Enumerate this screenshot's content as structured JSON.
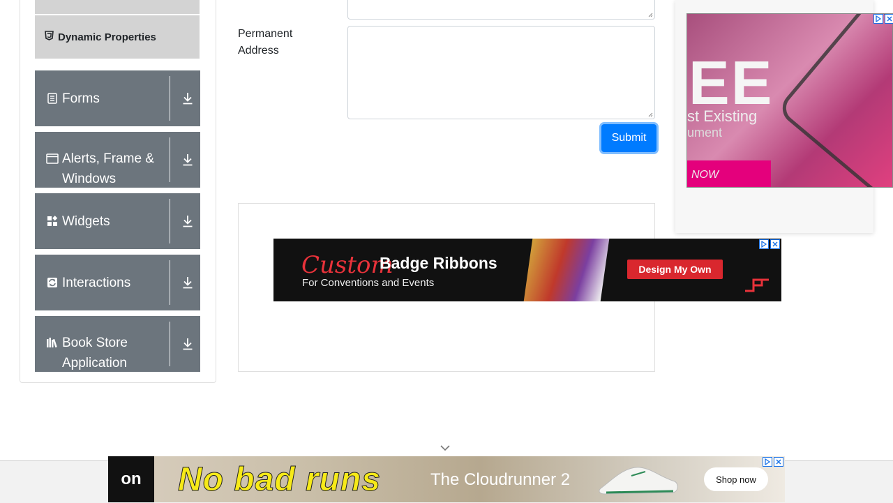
{
  "sidebar": {
    "active_sub_item": {
      "label": "Dynamic Properties",
      "icon": "html5-shield-icon"
    },
    "groups": [
      {
        "label": "Forms",
        "icon": "forms-icon"
      },
      {
        "label": "Alerts, Frame & Windows",
        "icon": "window-icon"
      },
      {
        "label": "Widgets",
        "icon": "widgets-icon"
      },
      {
        "label": "Interactions",
        "icon": "interactions-icon"
      },
      {
        "label": "Book Store Application",
        "icon": "books-icon"
      }
    ]
  },
  "form": {
    "permanent_address_label": "Permanent Address",
    "current_address_value": "",
    "permanent_address_value": "",
    "submit_label": "Submit"
  },
  "ads": {
    "right": {
      "headline": "EE",
      "line1": "st Existing",
      "line2": "ument",
      "line3": "NOW"
    },
    "middle": {
      "script_word": "Custom",
      "headline": "Badge Ribbons",
      "tagline": "For Conventions and Events",
      "cta": "Design My Own"
    },
    "bottom": {
      "brand": "on",
      "headline": "No bad runs",
      "product": "The Cloudrunner 2",
      "cta": "Shop now"
    }
  },
  "colors": {
    "sidebar_group_bg": "#6c757d",
    "sub_item_bg": "#d3d3d3",
    "primary": "#007bff"
  }
}
